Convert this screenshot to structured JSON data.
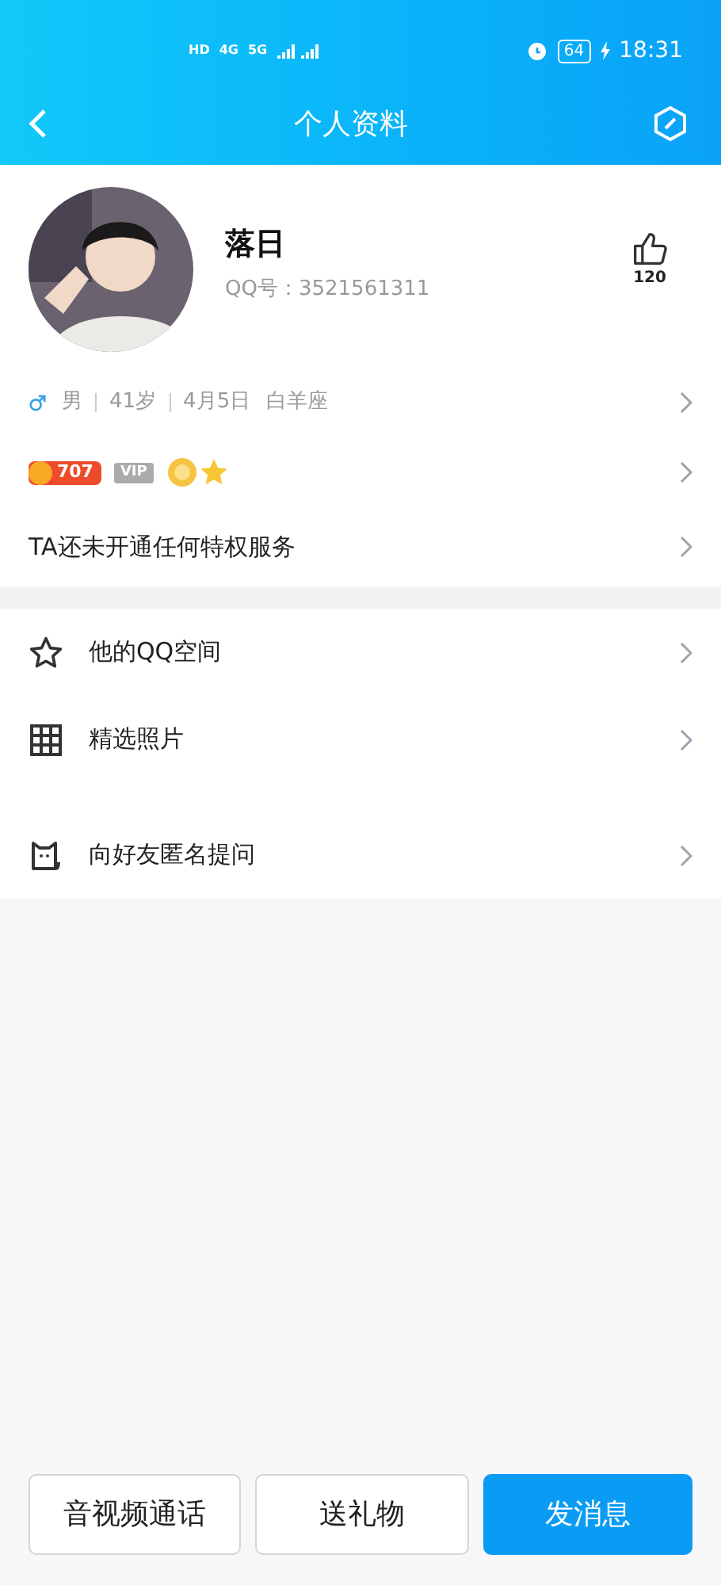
{
  "status_bar": {
    "network_labels": [
      "HD",
      "4G",
      "5G"
    ],
    "battery": "64",
    "time": "18:31"
  },
  "nav": {
    "title": "个人资料"
  },
  "profile": {
    "name": "落日",
    "qq_id": "QQ号：3521561311",
    "likes": "120"
  },
  "details": {
    "gender": "男",
    "age": "41岁",
    "birthday": "4月5日",
    "constellation": "白羊座"
  },
  "badges": {
    "level": "707",
    "vip": "VIP"
  },
  "privilege": "TA还未开通任何特权服务",
  "menu_groups": [
    [
      {
        "kind": "star",
        "label": "他的QQ空间"
      },
      {
        "kind": "grid",
        "label": "精选照片"
      }
    ],
    [
      {
        "kind": "cat",
        "label": "向好友匿名提问"
      }
    ]
  ],
  "actions": [
    {
      "label": "音视频通话",
      "primary": false
    },
    {
      "label": "送礼物",
      "primary": false
    },
    {
      "label": "发消息",
      "primary": true
    }
  ]
}
